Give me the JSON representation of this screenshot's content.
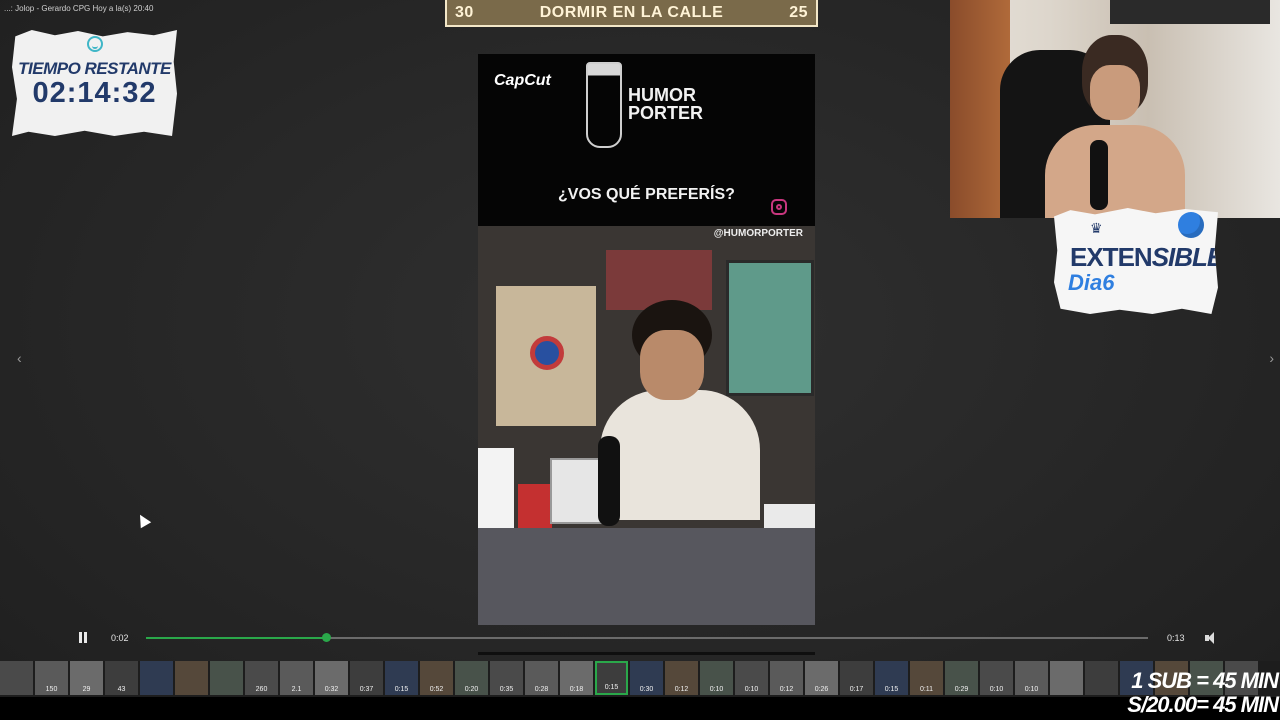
{
  "window_title": "...: Jolop - Gerardo CPG Hoy a la(s) 20:40",
  "scoreboard": {
    "left": "30",
    "title": "DORMIR EN LA CALLE",
    "right": "25"
  },
  "timer": {
    "label": "TIEMPO RESTANTE",
    "value": "02:14:32"
  },
  "extensible": {
    "line1a": "EXTEN",
    "line1b": "SIBLE",
    "line2": "Dia6"
  },
  "video": {
    "brand": "CapCut",
    "show_title_1": "HUMOR",
    "show_title_2": "PORTER",
    "question": "¿VOS QUÉ PREFERÍS?",
    "handle": "@HUMORPORTER"
  },
  "player": {
    "time_current": "0:02",
    "time_total": "0:13",
    "progress": 0.18
  },
  "thumbnails": [
    {
      "dur": ""
    },
    {
      "dur": "150"
    },
    {
      "dur": "29"
    },
    {
      "dur": "43"
    },
    {
      "dur": ""
    },
    {
      "dur": ""
    },
    {
      "dur": ""
    },
    {
      "dur": "260"
    },
    {
      "dur": "2.1"
    },
    {
      "dur": "0:32"
    },
    {
      "dur": "0:37"
    },
    {
      "dur": "0:15"
    },
    {
      "dur": "0:52"
    },
    {
      "dur": "0:20"
    },
    {
      "dur": "0:35"
    },
    {
      "dur": "0:28"
    },
    {
      "dur": "0:18"
    },
    {
      "dur": "0:15",
      "active": true
    },
    {
      "dur": "0:30"
    },
    {
      "dur": "0:12"
    },
    {
      "dur": "0:10"
    },
    {
      "dur": "0:10"
    },
    {
      "dur": "0:12"
    },
    {
      "dur": "0:26"
    },
    {
      "dur": "0:17"
    },
    {
      "dur": "0:15"
    },
    {
      "dur": "0:11"
    },
    {
      "dur": "0:29"
    },
    {
      "dur": "0:10"
    },
    {
      "dur": "0:10"
    },
    {
      "dur": ""
    },
    {
      "dur": ""
    },
    {
      "dur": ""
    },
    {
      "dur": ""
    },
    {
      "dur": ""
    },
    {
      "dur": ""
    }
  ],
  "promo": {
    "line1": "1 SUB = 45 MIN",
    "line2": "S/20.00= 45 MIN"
  }
}
